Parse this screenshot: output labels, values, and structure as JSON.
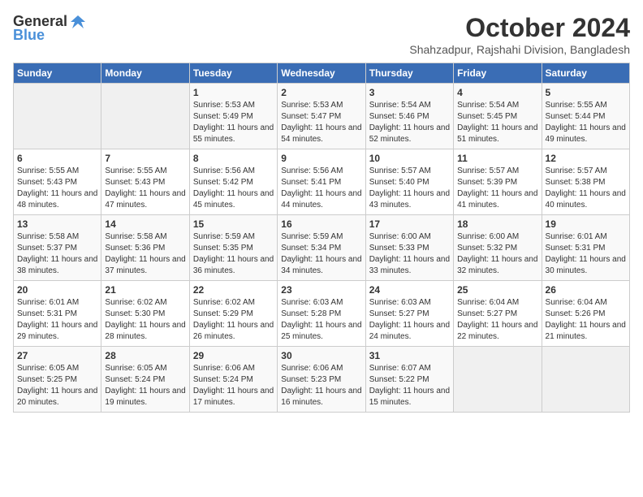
{
  "header": {
    "logo_general": "General",
    "logo_blue": "Blue",
    "month_title": "October 2024",
    "location": "Shahzadpur, Rajshahi Division, Bangladesh"
  },
  "weekdays": [
    "Sunday",
    "Monday",
    "Tuesday",
    "Wednesday",
    "Thursday",
    "Friday",
    "Saturday"
  ],
  "weeks": [
    [
      {
        "day": "",
        "empty": true
      },
      {
        "day": "",
        "empty": true
      },
      {
        "day": "1",
        "sunrise": "Sunrise: 5:53 AM",
        "sunset": "Sunset: 5:49 PM",
        "daylight": "Daylight: 11 hours and 55 minutes."
      },
      {
        "day": "2",
        "sunrise": "Sunrise: 5:53 AM",
        "sunset": "Sunset: 5:47 PM",
        "daylight": "Daylight: 11 hours and 54 minutes."
      },
      {
        "day": "3",
        "sunrise": "Sunrise: 5:54 AM",
        "sunset": "Sunset: 5:46 PM",
        "daylight": "Daylight: 11 hours and 52 minutes."
      },
      {
        "day": "4",
        "sunrise": "Sunrise: 5:54 AM",
        "sunset": "Sunset: 5:45 PM",
        "daylight": "Daylight: 11 hours and 51 minutes."
      },
      {
        "day": "5",
        "sunrise": "Sunrise: 5:55 AM",
        "sunset": "Sunset: 5:44 PM",
        "daylight": "Daylight: 11 hours and 49 minutes."
      }
    ],
    [
      {
        "day": "6",
        "sunrise": "Sunrise: 5:55 AM",
        "sunset": "Sunset: 5:43 PM",
        "daylight": "Daylight: 11 hours and 48 minutes."
      },
      {
        "day": "7",
        "sunrise": "Sunrise: 5:55 AM",
        "sunset": "Sunset: 5:43 PM",
        "daylight": "Daylight: 11 hours and 47 minutes."
      },
      {
        "day": "8",
        "sunrise": "Sunrise: 5:56 AM",
        "sunset": "Sunset: 5:42 PM",
        "daylight": "Daylight: 11 hours and 45 minutes."
      },
      {
        "day": "9",
        "sunrise": "Sunrise: 5:56 AM",
        "sunset": "Sunset: 5:41 PM",
        "daylight": "Daylight: 11 hours and 44 minutes."
      },
      {
        "day": "10",
        "sunrise": "Sunrise: 5:57 AM",
        "sunset": "Sunset: 5:40 PM",
        "daylight": "Daylight: 11 hours and 43 minutes."
      },
      {
        "day": "11",
        "sunrise": "Sunrise: 5:57 AM",
        "sunset": "Sunset: 5:39 PM",
        "daylight": "Daylight: 11 hours and 41 minutes."
      },
      {
        "day": "12",
        "sunrise": "Sunrise: 5:57 AM",
        "sunset": "Sunset: 5:38 PM",
        "daylight": "Daylight: 11 hours and 40 minutes."
      }
    ],
    [
      {
        "day": "13",
        "sunrise": "Sunrise: 5:58 AM",
        "sunset": "Sunset: 5:37 PM",
        "daylight": "Daylight: 11 hours and 38 minutes."
      },
      {
        "day": "14",
        "sunrise": "Sunrise: 5:58 AM",
        "sunset": "Sunset: 5:36 PM",
        "daylight": "Daylight: 11 hours and 37 minutes."
      },
      {
        "day": "15",
        "sunrise": "Sunrise: 5:59 AM",
        "sunset": "Sunset: 5:35 PM",
        "daylight": "Daylight: 11 hours and 36 minutes."
      },
      {
        "day": "16",
        "sunrise": "Sunrise: 5:59 AM",
        "sunset": "Sunset: 5:34 PM",
        "daylight": "Daylight: 11 hours and 34 minutes."
      },
      {
        "day": "17",
        "sunrise": "Sunrise: 6:00 AM",
        "sunset": "Sunset: 5:33 PM",
        "daylight": "Daylight: 11 hours and 33 minutes."
      },
      {
        "day": "18",
        "sunrise": "Sunrise: 6:00 AM",
        "sunset": "Sunset: 5:32 PM",
        "daylight": "Daylight: 11 hours and 32 minutes."
      },
      {
        "day": "19",
        "sunrise": "Sunrise: 6:01 AM",
        "sunset": "Sunset: 5:31 PM",
        "daylight": "Daylight: 11 hours and 30 minutes."
      }
    ],
    [
      {
        "day": "20",
        "sunrise": "Sunrise: 6:01 AM",
        "sunset": "Sunset: 5:31 PM",
        "daylight": "Daylight: 11 hours and 29 minutes."
      },
      {
        "day": "21",
        "sunrise": "Sunrise: 6:02 AM",
        "sunset": "Sunset: 5:30 PM",
        "daylight": "Daylight: 11 hours and 28 minutes."
      },
      {
        "day": "22",
        "sunrise": "Sunrise: 6:02 AM",
        "sunset": "Sunset: 5:29 PM",
        "daylight": "Daylight: 11 hours and 26 minutes."
      },
      {
        "day": "23",
        "sunrise": "Sunrise: 6:03 AM",
        "sunset": "Sunset: 5:28 PM",
        "daylight": "Daylight: 11 hours and 25 minutes."
      },
      {
        "day": "24",
        "sunrise": "Sunrise: 6:03 AM",
        "sunset": "Sunset: 5:27 PM",
        "daylight": "Daylight: 11 hours and 24 minutes."
      },
      {
        "day": "25",
        "sunrise": "Sunrise: 6:04 AM",
        "sunset": "Sunset: 5:27 PM",
        "daylight": "Daylight: 11 hours and 22 minutes."
      },
      {
        "day": "26",
        "sunrise": "Sunrise: 6:04 AM",
        "sunset": "Sunset: 5:26 PM",
        "daylight": "Daylight: 11 hours and 21 minutes."
      }
    ],
    [
      {
        "day": "27",
        "sunrise": "Sunrise: 6:05 AM",
        "sunset": "Sunset: 5:25 PM",
        "daylight": "Daylight: 11 hours and 20 minutes."
      },
      {
        "day": "28",
        "sunrise": "Sunrise: 6:05 AM",
        "sunset": "Sunset: 5:24 PM",
        "daylight": "Daylight: 11 hours and 19 minutes."
      },
      {
        "day": "29",
        "sunrise": "Sunrise: 6:06 AM",
        "sunset": "Sunset: 5:24 PM",
        "daylight": "Daylight: 11 hours and 17 minutes."
      },
      {
        "day": "30",
        "sunrise": "Sunrise: 6:06 AM",
        "sunset": "Sunset: 5:23 PM",
        "daylight": "Daylight: 11 hours and 16 minutes."
      },
      {
        "day": "31",
        "sunrise": "Sunrise: 6:07 AM",
        "sunset": "Sunset: 5:22 PM",
        "daylight": "Daylight: 11 hours and 15 minutes."
      },
      {
        "day": "",
        "empty": true
      },
      {
        "day": "",
        "empty": true
      }
    ]
  ]
}
